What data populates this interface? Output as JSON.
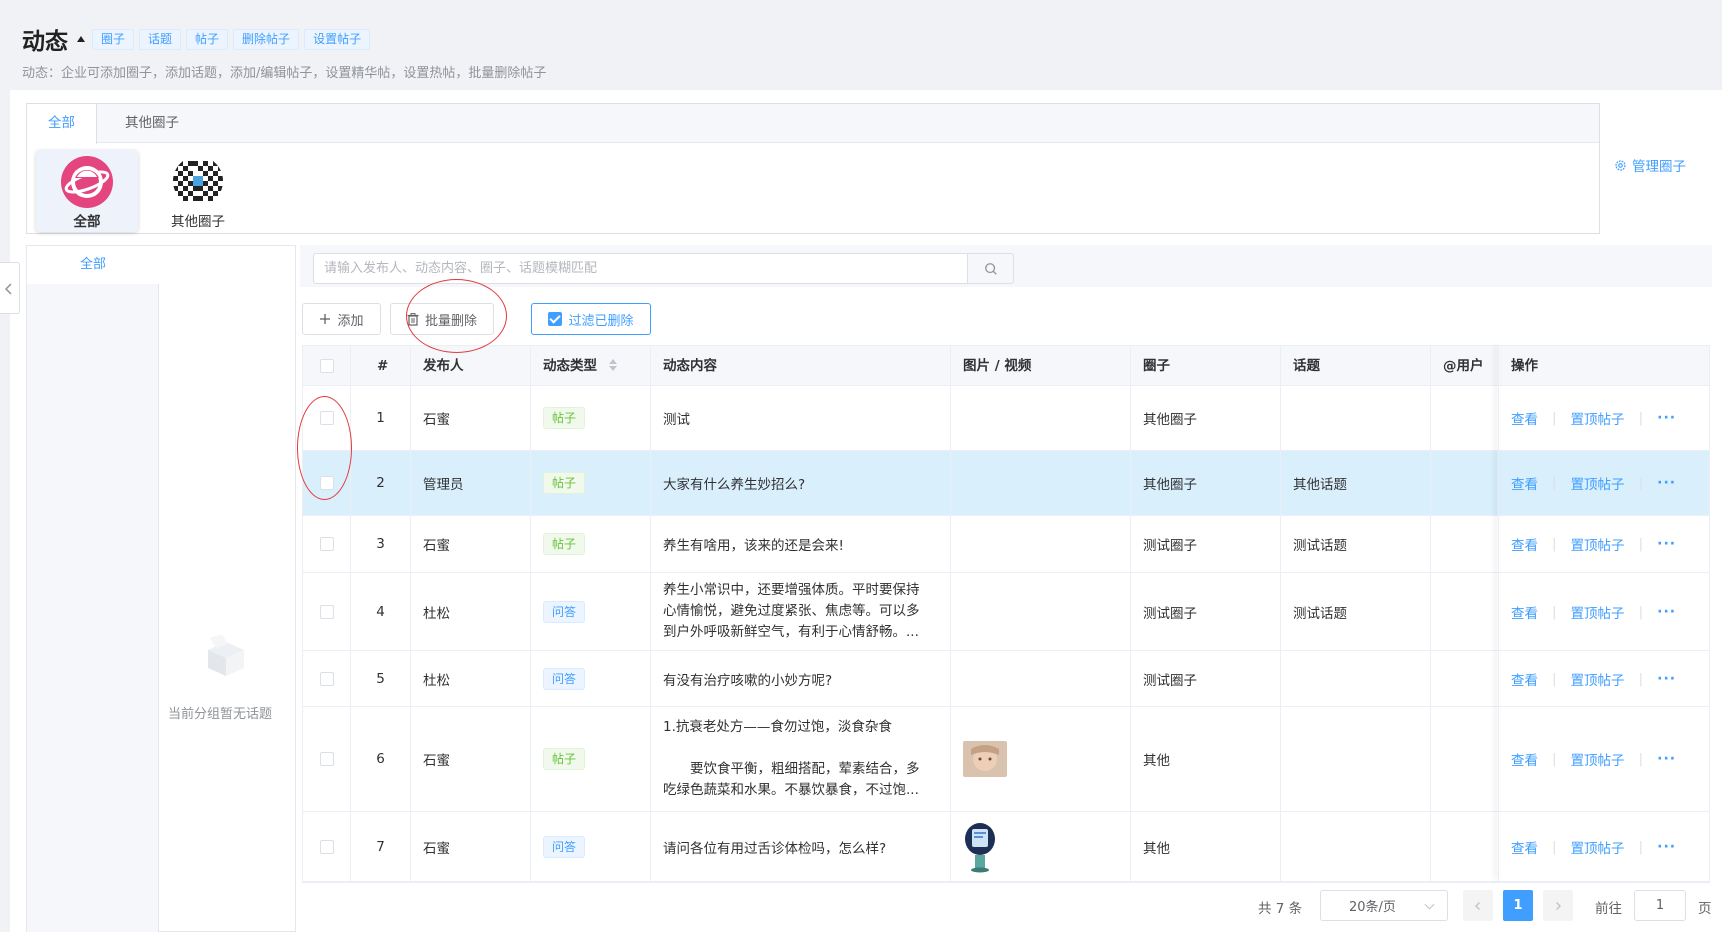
{
  "header": {
    "title": "动态",
    "tags": [
      "圈子",
      "话题",
      "帖子",
      "删除帖子",
      "设置帖子"
    ],
    "subtitle": "动态：企业可添加圈子，添加话题，添加/编辑帖子，设置精华帖，设置热帖，批量删除帖子"
  },
  "circles": {
    "tabs": [
      "全部",
      "其他圈子"
    ],
    "cards": [
      "全部",
      "其他圈子"
    ],
    "manage_label": "管理圈子"
  },
  "tree": {
    "all_label": "全部",
    "empty_text": "当前分组暂无话题"
  },
  "search": {
    "placeholder": "请输入发布人、动态内容、圈子、话题模糊匹配"
  },
  "toolbar": {
    "add_label": "添加",
    "batch_delete_label": "批量删除",
    "filter_deleted_label": "过滤已删除"
  },
  "table": {
    "headers": [
      "#",
      "发布人",
      "动态类型",
      "动态内容",
      "图片 / 视频",
      "圈子",
      "话题",
      "@用户",
      "操作"
    ],
    "rows": [
      {
        "num": "1",
        "author": "石蜜",
        "type": "帖子",
        "content": [
          "测试"
        ],
        "circle": "其他圈子",
        "topic": ""
      },
      {
        "num": "2",
        "author": "管理员",
        "type": "帖子",
        "content": [
          "大家有什么养生妙招么?"
        ],
        "circle": "其他圈子",
        "topic": "其他话题"
      },
      {
        "num": "3",
        "author": "石蜜",
        "type": "帖子",
        "content": [
          "养生有啥用，该来的还是会来!"
        ],
        "circle": "测试圈子",
        "topic": "测试话题"
      },
      {
        "num": "4",
        "author": "杜松",
        "type": "问答",
        "content": [
          "养生小常识中，还要增强体质。平时要保持",
          "心情愉悦，避免过度紧张、焦虑等。可以多",
          "到户外呼吸新鲜空气，有利于心情舒畅。..."
        ],
        "circle": "测试圈子",
        "topic": "测试话题"
      },
      {
        "num": "5",
        "author": "杜松",
        "type": "问答",
        "content": [
          "有没有治疗咳嗽的小妙方呢?"
        ],
        "circle": "测试圈子",
        "topic": ""
      },
      {
        "num": "6",
        "author": "石蜜",
        "type": "帖子",
        "content": [
          "1.抗衰老处方——食勿过饱，淡食杂食",
          "",
          "　　要饮食平衡，粗细搭配，荤素结合，多",
          "吃绿色蔬菜和水果。不暴饮暴食，不过饱..."
        ],
        "circle": "其他",
        "topic": ""
      },
      {
        "num": "7",
        "author": "石蜜",
        "type": "问答",
        "content": [
          "请问各位有用过舌诊体检吗，怎么样?"
        ],
        "circle": "其他",
        "topic": ""
      }
    ],
    "ops": {
      "view": "查看",
      "pin": "置顶帖子",
      "more": "···"
    }
  },
  "pagination": {
    "total": "共 7 条",
    "page_size": "20条/页",
    "current_page": "1",
    "goto_label": "前往",
    "goto_value": "1",
    "page_unit": "页"
  },
  "colors": {
    "primary": "#409eff",
    "success": "#67c23a",
    "annotation": "#e23b3b",
    "highlight_row": "#d9effc"
  }
}
